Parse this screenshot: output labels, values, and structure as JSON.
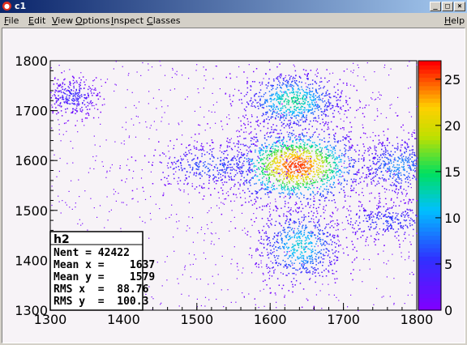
{
  "window": {
    "title": "c1",
    "minimize_label": "_",
    "maximize_label": "□",
    "close_label": "×"
  },
  "menu": {
    "items": [
      "File",
      "Edit",
      "View",
      "Options",
      "Inspect",
      "Classes"
    ],
    "help": "Help"
  },
  "stats": {
    "name": "h2",
    "lines": [
      "Nent = 42422",
      "Mean x =    1637",
      "Mean y =    1579",
      "RMS x  =  88.76",
      "RMS y  =  100.3"
    ]
  },
  "chart_data": {
    "type": "heatmap",
    "title": "",
    "xlabel": "",
    "ylabel": "",
    "xlim": [
      1300,
      1800
    ],
    "ylim": [
      1300,
      1800
    ],
    "x_ticks": [
      1300,
      1400,
      1500,
      1600,
      1700,
      1800
    ],
    "y_ticks": [
      1300,
      1400,
      1500,
      1600,
      1700,
      1800
    ],
    "z_ticks": [
      0,
      5,
      10,
      15,
      20,
      25
    ],
    "zlim": [
      0,
      27
    ],
    "entries": 42422,
    "mean_x": 1637,
    "mean_y": 1579,
    "rms_x": 88.76,
    "rms_y": 100.3,
    "clusters": [
      {
        "x": 1635,
        "y": 1590,
        "sx": 45,
        "sy": 38,
        "peak": 26
      },
      {
        "x": 1630,
        "y": 1720,
        "sx": 35,
        "sy": 30,
        "peak": 14
      },
      {
        "x": 1640,
        "y": 1430,
        "sx": 30,
        "sy": 40,
        "peak": 12
      },
      {
        "x": 1520,
        "y": 1590,
        "sx": 45,
        "sy": 25,
        "peak": 7
      },
      {
        "x": 1775,
        "y": 1590,
        "sx": 30,
        "sy": 30,
        "peak": 9
      },
      {
        "x": 1330,
        "y": 1730,
        "sx": 18,
        "sy": 20,
        "peak": 5
      },
      {
        "x": 1760,
        "y": 1480,
        "sx": 40,
        "sy": 20,
        "peak": 6
      }
    ],
    "grid": false,
    "palette_position": "right"
  }
}
